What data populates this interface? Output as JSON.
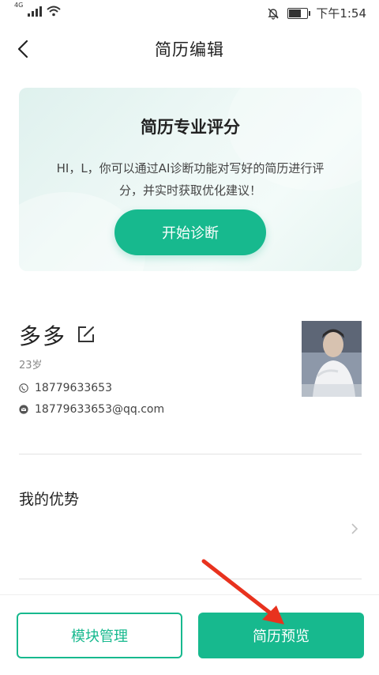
{
  "status_bar": {
    "network": "4G",
    "time": "下午1:54"
  },
  "header": {
    "title": "简历编辑"
  },
  "score_card": {
    "title": "简历专业评分",
    "description": "HI，L，你可以通过AI诊断功能对写好的简历进行评分，并实时获取优化建议！",
    "button_label": "开始诊断"
  },
  "profile": {
    "name": "多多",
    "age": "23岁",
    "phone": "18779633653",
    "email": "18779633653@qq.com"
  },
  "advantage_section": {
    "title": "我的优势"
  },
  "bottom_bar": {
    "module_label": "模块管理",
    "preview_label": "简历预览"
  },
  "colors": {
    "accent": "#17b98e",
    "annotation_arrow": "#e8321e"
  },
  "icons": [
    "back-arrow-icon",
    "edit-icon",
    "phone-icon",
    "email-icon",
    "chevron-right-icon",
    "signal-icon",
    "wifi-icon",
    "mute-bell-icon",
    "battery-icon"
  ]
}
